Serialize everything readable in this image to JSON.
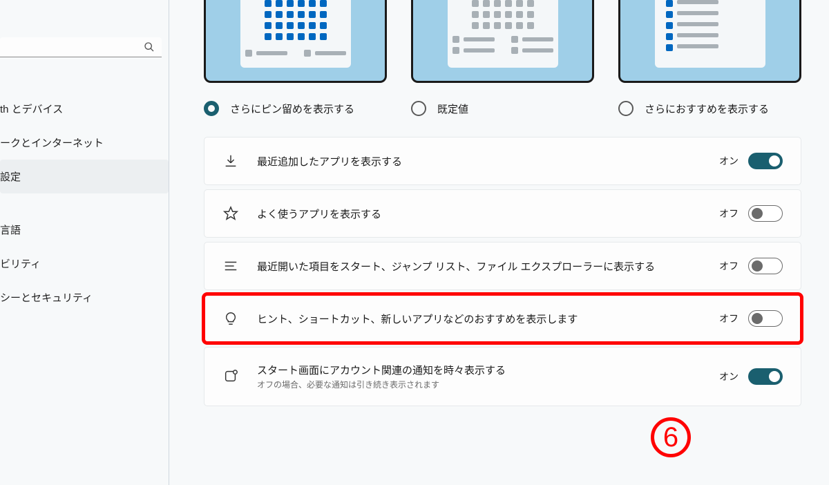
{
  "sidebar": {
    "search_placeholder": "",
    "items": [
      {
        "label": "th とデバイス",
        "active": false
      },
      {
        "label": "ークとインターネット",
        "active": false
      },
      {
        "label": "設定",
        "active": true
      },
      {
        "label": "",
        "active": false
      },
      {
        "label": "言語",
        "active": false
      },
      {
        "label": "ビリティ",
        "active": false
      },
      {
        "label": "シーとセキュリティ",
        "active": false
      }
    ]
  },
  "layout_options": [
    {
      "label": "さらにピン留めを表示する",
      "selected": true
    },
    {
      "label": "既定値",
      "selected": false
    },
    {
      "label": "さらにおすすめを表示する",
      "selected": false
    }
  ],
  "settings": [
    {
      "icon": "download",
      "title": "最近追加したアプリを表示する",
      "sub": "",
      "state": "on",
      "state_label": "オン",
      "highlighted": false
    },
    {
      "icon": "star",
      "title": "よく使うアプリを表示する",
      "sub": "",
      "state": "off",
      "state_label": "オフ",
      "highlighted": false
    },
    {
      "icon": "list",
      "title": "最近開いた項目をスタート、ジャンプ リスト、ファイル エクスプローラーに表示する",
      "sub": "",
      "state": "off",
      "state_label": "オフ",
      "highlighted": false
    },
    {
      "icon": "bulb",
      "title": "ヒント、ショートカット、新しいアプリなどのおすすめを表示します",
      "sub": "",
      "state": "off",
      "state_label": "オフ",
      "highlighted": true
    },
    {
      "icon": "notification",
      "title": "スタート画面にアカウント関連の通知を時々表示する",
      "sub": "オフの場合、必要な通知は引き続き表示されます",
      "state": "on",
      "state_label": "オン",
      "highlighted": false
    }
  ],
  "annotation": "6"
}
